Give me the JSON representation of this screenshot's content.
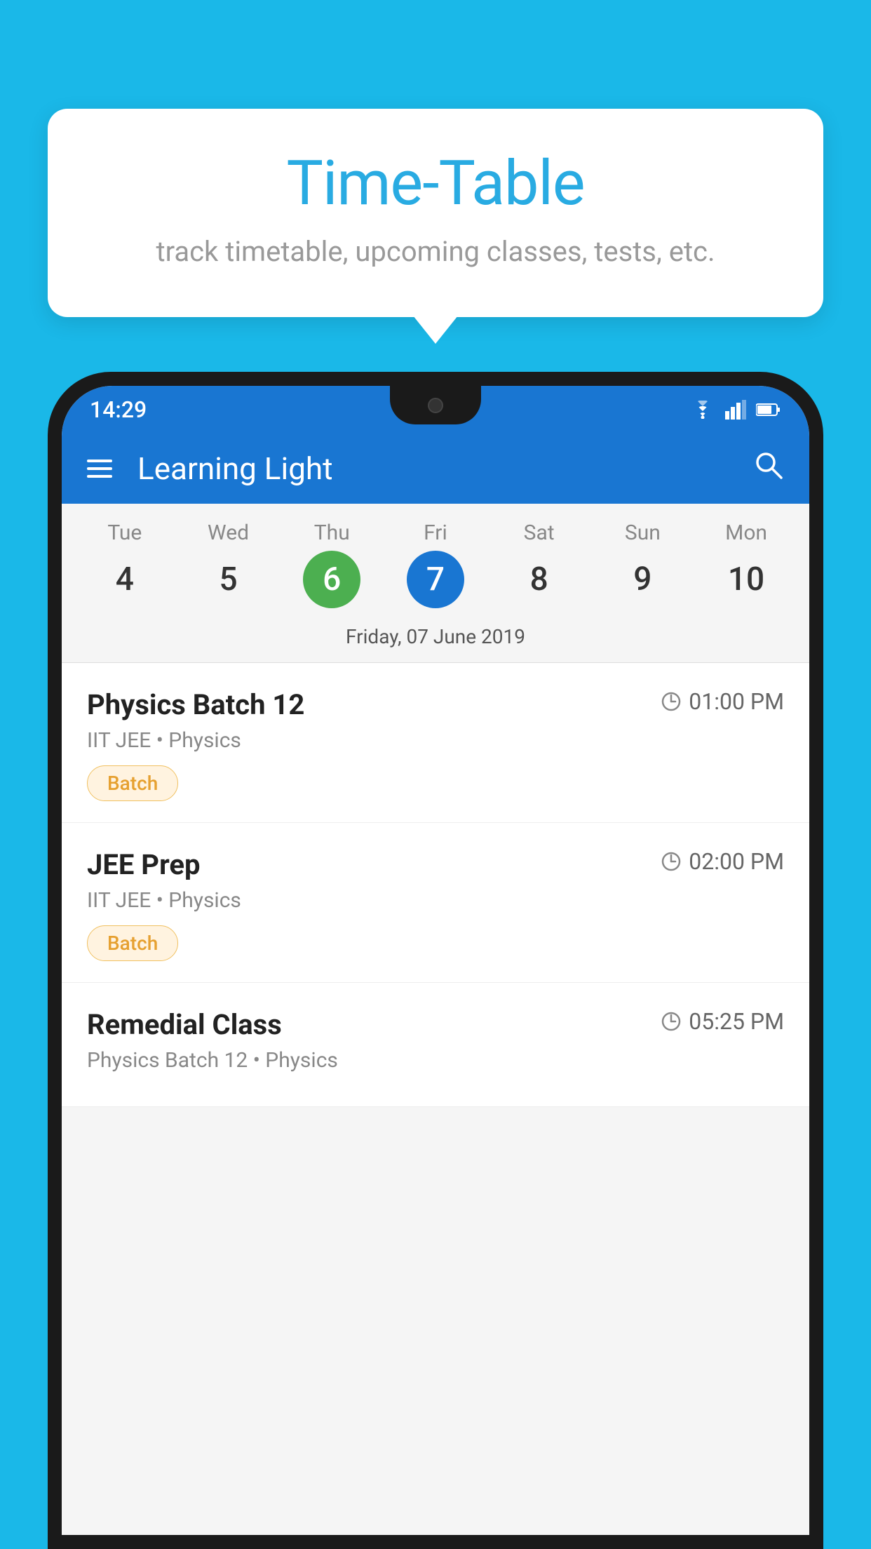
{
  "background_color": "#1ab8e8",
  "tooltip": {
    "title": "Time-Table",
    "subtitle": "track timetable, upcoming classes, tests, etc."
  },
  "phone": {
    "status_bar": {
      "time": "14:29"
    },
    "app_bar": {
      "title": "Learning Light"
    },
    "calendar": {
      "days": [
        {
          "name": "Tue",
          "num": "4",
          "state": "normal"
        },
        {
          "name": "Wed",
          "num": "5",
          "state": "normal"
        },
        {
          "name": "Thu",
          "num": "6",
          "state": "today"
        },
        {
          "name": "Fri",
          "num": "7",
          "state": "selected"
        },
        {
          "name": "Sat",
          "num": "8",
          "state": "normal"
        },
        {
          "name": "Sun",
          "num": "9",
          "state": "normal"
        },
        {
          "name": "Mon",
          "num": "10",
          "state": "normal"
        }
      ],
      "selected_date_label": "Friday, 07 June 2019"
    },
    "schedule": [
      {
        "title": "Physics Batch 12",
        "time": "01:00 PM",
        "subtitle": "IIT JEE • Physics",
        "badge": "Batch"
      },
      {
        "title": "JEE Prep",
        "time": "02:00 PM",
        "subtitle": "IIT JEE • Physics",
        "badge": "Batch"
      },
      {
        "title": "Remedial Class",
        "time": "05:25 PM",
        "subtitle": "Physics Batch 12 • Physics",
        "badge": null
      }
    ]
  }
}
